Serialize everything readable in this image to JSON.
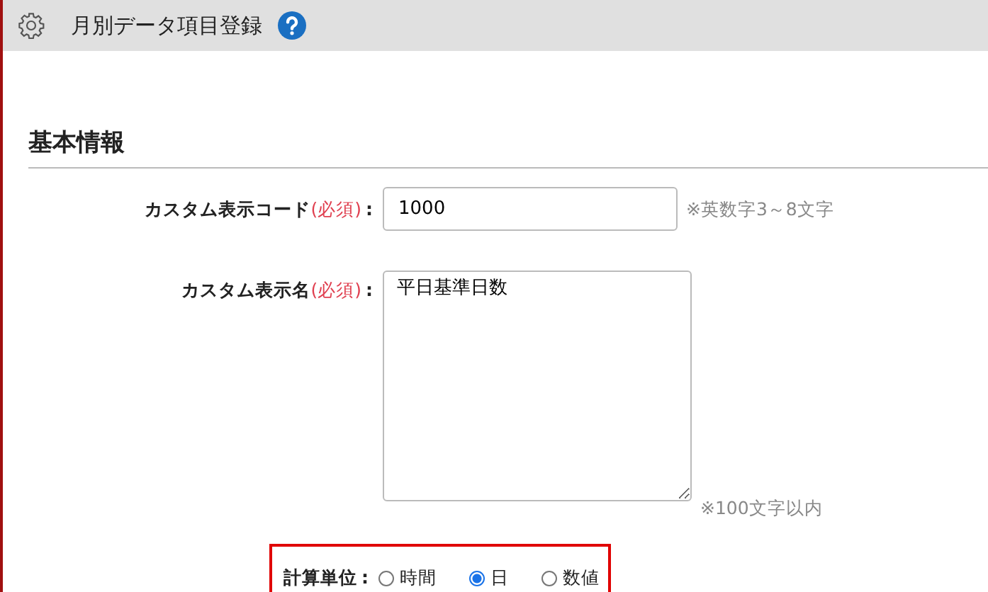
{
  "header": {
    "title": "月別データ項目登録"
  },
  "section": {
    "heading": "基本情報"
  },
  "fields": [
    {
      "kind": "text",
      "label": "カスタム表示コード",
      "required": "(必須)",
      "separator": ":",
      "value": "1000",
      "hint": "※英数字3～8文字"
    },
    {
      "kind": "textarea",
      "label": "カスタム表示名",
      "required": "(必須)",
      "separator": ":",
      "value": "平日基準日数",
      "hint": "※100文字以内"
    },
    {
      "kind": "radio",
      "label": "計算単位",
      "separator": ":",
      "highlighted": true,
      "options": [
        {
          "label": "時間",
          "selected": false
        },
        {
          "label": "日",
          "selected": true
        },
        {
          "label": "数値",
          "selected": false
        }
      ]
    }
  ]
}
